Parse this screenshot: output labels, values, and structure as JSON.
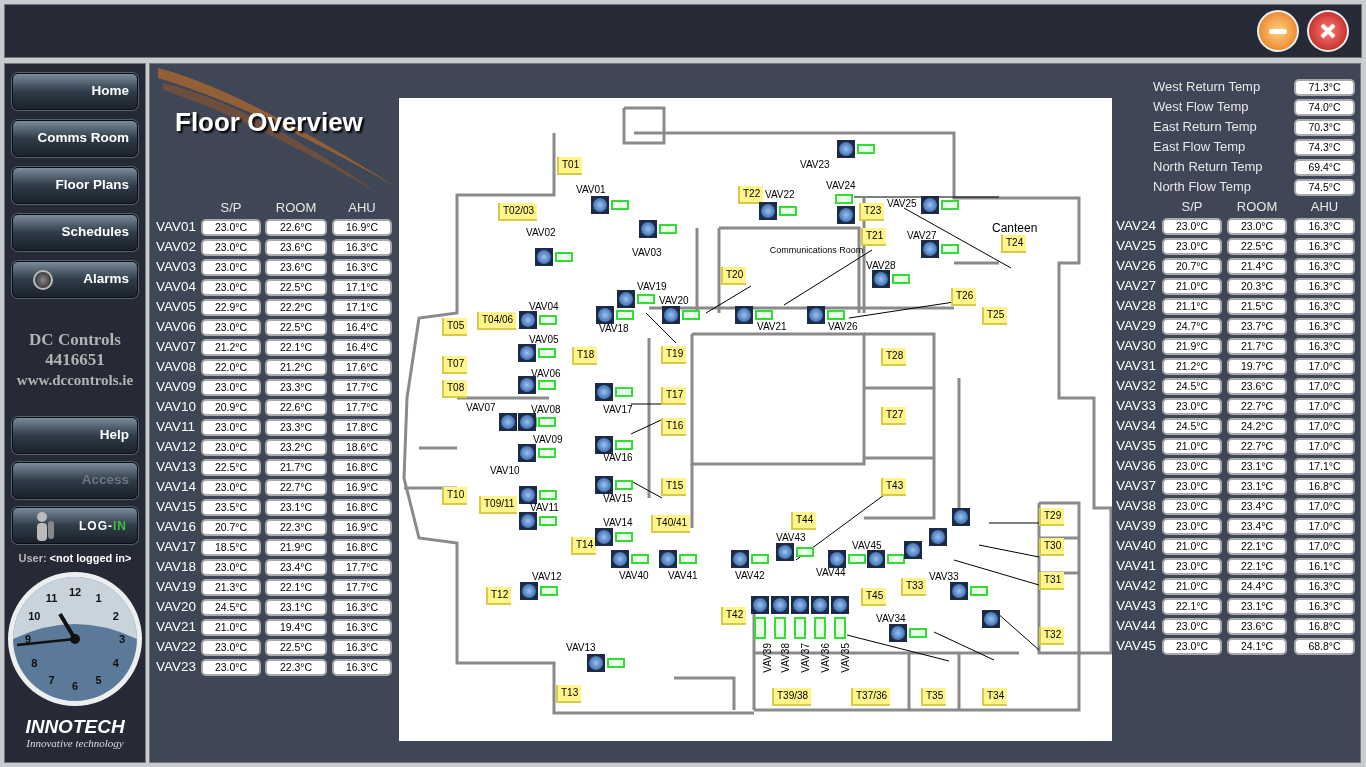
{
  "window_controls": [
    {
      "kind": "minimize"
    },
    {
      "kind": "close"
    }
  ],
  "sidebar": {
    "nav": [
      {
        "label": "Home",
        "kind": "plain"
      },
      {
        "label": "Comms Room",
        "kind": "plain"
      },
      {
        "label": "Floor Plans",
        "kind": "plain"
      },
      {
        "label": "Schedules",
        "kind": "plain"
      },
      {
        "label": "Alarms",
        "kind": "alarm"
      }
    ],
    "company": [
      "DC Controls",
      "4416651",
      "www.dccontrols.ie"
    ],
    "secondary": [
      {
        "label": "Help",
        "disabled": false
      },
      {
        "label": "Access",
        "disabled": true
      }
    ],
    "login": {
      "label": "LOG-",
      "highlight": "IN"
    },
    "user": {
      "label": "User:",
      "value": "<not logged in>"
    },
    "clock": {
      "numerals": [
        "12",
        "1",
        "2",
        "3",
        "4",
        "5",
        "6",
        "7",
        "8",
        "9",
        "10",
        "11"
      ]
    },
    "logo": {
      "name": "INNOTECH",
      "tagline": "Innovative technology"
    }
  },
  "page_title": "Floor Overview",
  "left_table": {
    "columns": [
      "S/P",
      "ROOM",
      "AHU"
    ],
    "rows": [
      {
        "name": "VAV01",
        "values": [
          "23.0°C",
          "22.6°C",
          "16.9°C"
        ]
      },
      {
        "name": "VAV02",
        "values": [
          "23.0°C",
          "23.6°C",
          "16.3°C"
        ]
      },
      {
        "name": "VAV03",
        "values": [
          "23.0°C",
          "23.6°C",
          "16.3°C"
        ]
      },
      {
        "name": "VAV04",
        "values": [
          "23.0°C",
          "22.5°C",
          "17.1°C"
        ]
      },
      {
        "name": "VAV05",
        "values": [
          "22.9°C",
          "22.2°C",
          "17.1°C"
        ]
      },
      {
        "name": "VAV06",
        "values": [
          "23.0°C",
          "22.5°C",
          "16.4°C"
        ]
      },
      {
        "name": "VAV07",
        "values": [
          "21.2°C",
          "22.1°C",
          "16.4°C"
        ]
      },
      {
        "name": "VAV08",
        "values": [
          "22.0°C",
          "21.2°C",
          "17.6°C"
        ]
      },
      {
        "name": "VAV09",
        "values": [
          "23.0°C",
          "23.3°C",
          "17.7°C"
        ]
      },
      {
        "name": "VAV10",
        "values": [
          "20.9°C",
          "22.6°C",
          "17.7°C"
        ]
      },
      {
        "name": "VAV11",
        "values": [
          "23.0°C",
          "23.3°C",
          "17.8°C"
        ]
      },
      {
        "name": "VAV12",
        "values": [
          "23.0°C",
          "23.2°C",
          "18.6°C"
        ]
      },
      {
        "name": "VAV13",
        "values": [
          "22.5°C",
          "21.7°C",
          "16.8°C"
        ]
      },
      {
        "name": "VAV14",
        "values": [
          "23.0°C",
          "22.7°C",
          "16.9°C"
        ]
      },
      {
        "name": "VAV15",
        "values": [
          "23.5°C",
          "23.1°C",
          "16.8°C"
        ]
      },
      {
        "name": "VAV16",
        "values": [
          "20.7°C",
          "22.3°C",
          "16.9°C"
        ]
      },
      {
        "name": "VAV17",
        "values": [
          "18.5°C",
          "21.9°C",
          "16.8°C"
        ]
      },
      {
        "name": "VAV18",
        "values": [
          "23.0°C",
          "23.4°C",
          "17.7°C"
        ]
      },
      {
        "name": "VAV19",
        "values": [
          "21.3°C",
          "22.1°C",
          "17.7°C"
        ]
      },
      {
        "name": "VAV20",
        "values": [
          "24.5°C",
          "23.1°C",
          "16.3°C"
        ]
      },
      {
        "name": "VAV21",
        "values": [
          "21.0°C",
          "19.4°C",
          "16.3°C"
        ]
      },
      {
        "name": "VAV22",
        "values": [
          "23.0°C",
          "22.5°C",
          "16.3°C"
        ]
      },
      {
        "name": "VAV23",
        "values": [
          "23.0°C",
          "22.3°C",
          "16.3°C"
        ]
      }
    ]
  },
  "floor_plan": {
    "rooms": [
      "Canteen",
      "Communications Room"
    ],
    "thermostats": [
      "T01",
      "T02/03",
      "T04/06",
      "T05",
      "T07",
      "T08",
      "T09/11",
      "T10",
      "T12",
      "T13",
      "T14",
      "T17",
      "T16",
      "T15",
      "T18",
      "T19",
      "T20",
      "T21",
      "T22",
      "T23",
      "T24",
      "T25",
      "T26",
      "T28",
      "T27",
      "T29",
      "T30",
      "T31",
      "T32",
      "T33",
      "T39/38",
      "T37/36",
      "T35",
      "T34",
      "T40/41",
      "T42",
      "T43",
      "T44",
      "T45"
    ],
    "vavs": [
      {
        "label": "VAV01",
        "kind": "horizontal"
      },
      {
        "label": "VAV02",
        "kind": "horizontal"
      },
      {
        "label": "VAV03",
        "kind": "horizontal"
      },
      {
        "label": "VAV04",
        "kind": "horizontal"
      },
      {
        "label": "VAV05",
        "kind": "horizontal"
      },
      {
        "label": "VAV06",
        "kind": "horizontal"
      },
      {
        "label": "VAV07",
        "kind": "horizontal"
      },
      {
        "label": "VAV08",
        "kind": "horizontal"
      },
      {
        "label": "VAV09",
        "kind": "horizontal"
      },
      {
        "label": "VAV10",
        "kind": "horizontal"
      },
      {
        "label": "VAV11",
        "kind": "horizontal"
      },
      {
        "label": "VAV12",
        "kind": "horizontal"
      },
      {
        "label": "VAV13",
        "kind": "horizontal"
      },
      {
        "label": "VAV19",
        "kind": "horizontal"
      },
      {
        "label": "VAV18",
        "kind": "horizontal"
      },
      {
        "label": "VAV17",
        "kind": "horizontal"
      },
      {
        "label": "VAV16",
        "kind": "horizontal"
      },
      {
        "label": "VAV15",
        "kind": "horizontal"
      },
      {
        "label": "VAV14",
        "kind": "horizontal"
      },
      {
        "label": "VAV20",
        "kind": "horizontal"
      },
      {
        "label": "VAV21",
        "kind": "horizontal"
      },
      {
        "label": "VAV22",
        "kind": "horizontal"
      },
      {
        "label": "VAV23",
        "kind": "horizontal"
      },
      {
        "label": "VAV24",
        "kind": "horizontal"
      },
      {
        "label": "VAV25",
        "kind": "horizontal"
      },
      {
        "label": "VAV26",
        "kind": "horizontal"
      },
      {
        "label": "VAV27",
        "kind": "horizontal"
      },
      {
        "label": "VAV28",
        "kind": "horizontal"
      },
      {
        "label": "VAV33",
        "kind": "horizontal"
      },
      {
        "label": "VAV34",
        "kind": "horizontal"
      },
      {
        "label": "VAV35",
        "kind": "vertical"
      },
      {
        "label": "VAV36",
        "kind": "vertical"
      },
      {
        "label": "VAV37",
        "kind": "vertical"
      },
      {
        "label": "VAV38",
        "kind": "vertical"
      },
      {
        "label": "VAV39",
        "kind": "vertical"
      },
      {
        "label": "VAV40",
        "kind": "horizontal"
      },
      {
        "label": "VAV41",
        "kind": "horizontal"
      },
      {
        "label": "VAV42",
        "kind": "horizontal"
      },
      {
        "label": "VAV43",
        "kind": "horizontal"
      },
      {
        "label": "VAV44",
        "kind": "horizontal"
      },
      {
        "label": "VAV45",
        "kind": "horizontal"
      }
    ]
  },
  "supply_temps": [
    {
      "label": "West Return Temp",
      "value": "71.3°C"
    },
    {
      "label": "West Flow Temp",
      "value": "74.0°C"
    },
    {
      "label": "East Return Temp",
      "value": "70.3°C"
    },
    {
      "label": "East Flow Temp",
      "value": "74.3°C"
    },
    {
      "label": "North Return Temp",
      "value": "69.4°C"
    },
    {
      "label": "North Flow Temp",
      "value": "74.5°C"
    }
  ],
  "right_table": {
    "columns": [
      "S/P",
      "ROOM",
      "AHU"
    ],
    "rows": [
      {
        "name": "VAV24",
        "values": [
          "23.0°C",
          "23.0°C",
          "16.3°C"
        ]
      },
      {
        "name": "VAV25",
        "values": [
          "23.0°C",
          "22.5°C",
          "16.3°C"
        ]
      },
      {
        "name": "VAV26",
        "values": [
          "20.7°C",
          "21.4°C",
          "16.3°C"
        ]
      },
      {
        "name": "VAV27",
        "values": [
          "21.0°C",
          "20.3°C",
          "16.3°C"
        ]
      },
      {
        "name": "VAV28",
        "values": [
          "21.1°C",
          "21.5°C",
          "16.3°C"
        ]
      },
      {
        "name": "VAV29",
        "values": [
          "24.7°C",
          "23.7°C",
          "16.3°C"
        ]
      },
      {
        "name": "VAV30",
        "values": [
          "21.9°C",
          "21.7°C",
          "16.3°C"
        ]
      },
      {
        "name": "VAV31",
        "values": [
          "21.2°C",
          "19.7°C",
          "17.0°C"
        ]
      },
      {
        "name": "VAV32",
        "values": [
          "24.5°C",
          "23.6°C",
          "17.0°C"
        ]
      },
      {
        "name": "VAV33",
        "values": [
          "23.0°C",
          "22.7°C",
          "17.0°C"
        ]
      },
      {
        "name": "VAV34",
        "values": [
          "24.5°C",
          "24.2°C",
          "17.0°C"
        ]
      },
      {
        "name": "VAV35",
        "values": [
          "21.0°C",
          "22.7°C",
          "17.0°C"
        ]
      },
      {
        "name": "VAV36",
        "values": [
          "23.0°C",
          "23.1°C",
          "17.1°C"
        ]
      },
      {
        "name": "VAV37",
        "values": [
          "23.0°C",
          "23.1°C",
          "16.8°C"
        ]
      },
      {
        "name": "VAV38",
        "values": [
          "23.0°C",
          "23.4°C",
          "17.0°C"
        ]
      },
      {
        "name": "VAV39",
        "values": [
          "23.0°C",
          "23.4°C",
          "17.0°C"
        ]
      },
      {
        "name": "VAV40",
        "values": [
          "21.0°C",
          "22.1°C",
          "17.0°C"
        ]
      },
      {
        "name": "VAV41",
        "values": [
          "23.0°C",
          "22.1°C",
          "16.1°C"
        ]
      },
      {
        "name": "VAV42",
        "values": [
          "21.0°C",
          "24.4°C",
          "16.3°C"
        ]
      },
      {
        "name": "VAV43",
        "values": [
          "22.1°C",
          "23.1°C",
          "16.3°C"
        ]
      },
      {
        "name": "VAV44",
        "values": [
          "23.0°C",
          "23.6°C",
          "16.8°C"
        ]
      },
      {
        "name": "VAV45",
        "values": [
          "23.0°C",
          "24.1°C",
          "68.8°C"
        ]
      }
    ]
  }
}
